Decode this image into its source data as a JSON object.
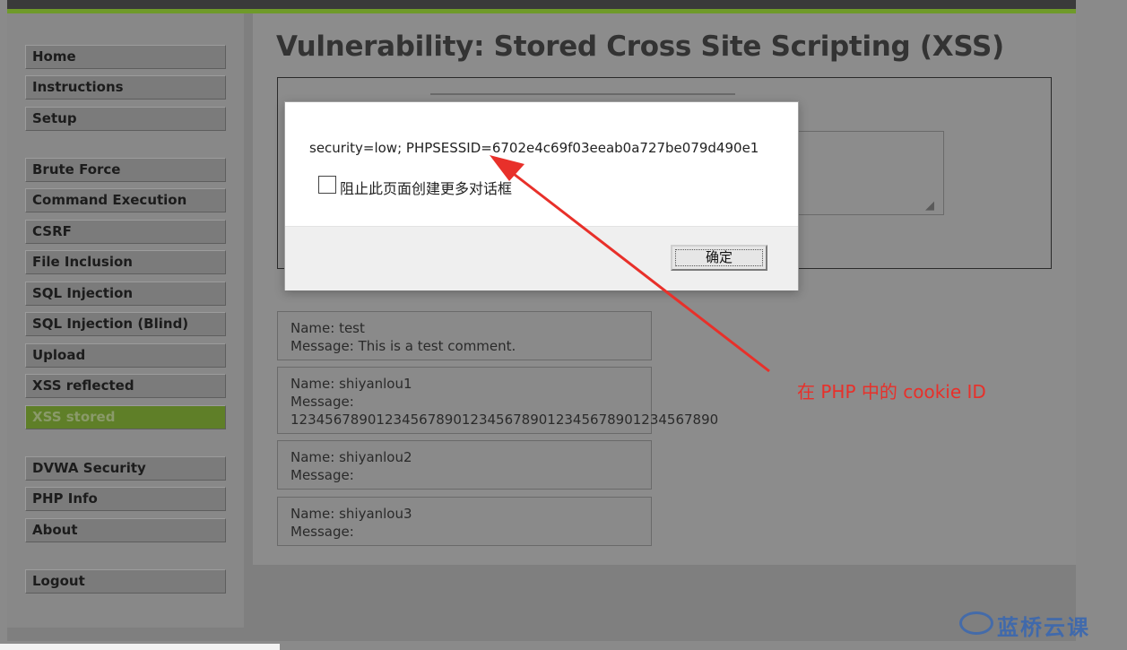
{
  "page": {
    "title": "Vulnerability: Stored Cross Site Scripting (XSS)"
  },
  "sidebar": {
    "items": [
      {
        "label": "Home",
        "selected": false
      },
      {
        "label": "Instructions",
        "selected": false
      },
      {
        "label": "Setup",
        "selected": false
      },
      {
        "label": "Brute Force",
        "selected": false
      },
      {
        "label": "Command Execution",
        "selected": false
      },
      {
        "label": "CSRF",
        "selected": false
      },
      {
        "label": "File Inclusion",
        "selected": false
      },
      {
        "label": "SQL Injection",
        "selected": false
      },
      {
        "label": "SQL Injection (Blind)",
        "selected": false
      },
      {
        "label": "Upload",
        "selected": false
      },
      {
        "label": "XSS reflected",
        "selected": false
      },
      {
        "label": "XSS stored",
        "selected": true
      },
      {
        "label": "DVWA Security",
        "selected": false
      },
      {
        "label": "PHP Info",
        "selected": false
      },
      {
        "label": "About",
        "selected": false
      },
      {
        "label": "Logout",
        "selected": false
      }
    ]
  },
  "comments": [
    {
      "name": "Name: test",
      "message": "Message: This is a test comment.",
      "extra": ""
    },
    {
      "name": "Name: shiyanlou1",
      "message": "Message:",
      "extra": "1234567890123456789012345678901234567890123456789​0"
    },
    {
      "name": "Name: shiyanlou2",
      "message": "Message:",
      "extra": ""
    },
    {
      "name": "Name: shiyanlou3",
      "message": "Message:",
      "extra": ""
    }
  ],
  "dialog": {
    "message": "security=low; PHPSESSID=6702e4c69f03eeab0a727be079d490e1",
    "checkbox_label": "阻止此页面创建更多对话框",
    "checkbox_checked": false,
    "ok_label": "确定"
  },
  "annotation": {
    "text": "在 PHP 中的 cookie ID",
    "color": "#e8302a"
  },
  "watermark": {
    "text": "蓝桥云课",
    "color": "#3a67b0"
  },
  "colors": {
    "accent_green": "#6f9a2a",
    "selected_item": "#5f7f28"
  }
}
